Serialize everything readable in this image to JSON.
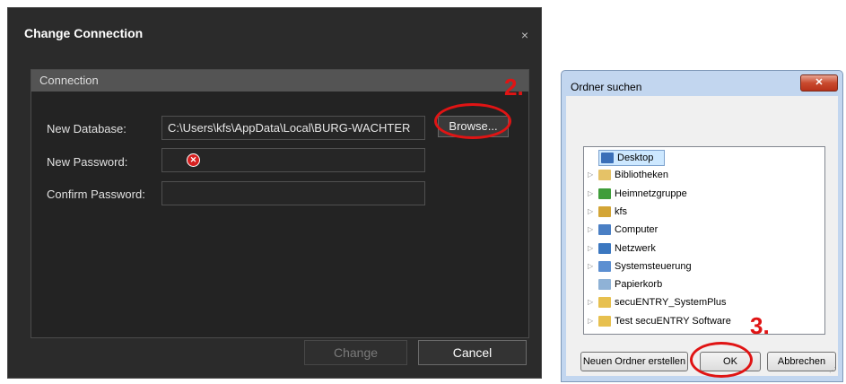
{
  "dark_dialog": {
    "title": "Change Connection",
    "close_glyph": "×",
    "section_header": "Connection",
    "new_database_label": "New Database:",
    "new_database_value": "C:\\Users\\kfs\\AppData\\Local\\BURG-WACHTER",
    "browse_label": "Browse...",
    "new_password_label": "New Password:",
    "confirm_password_label": "Confirm Password:",
    "change_label": "Change",
    "cancel_label": "Cancel",
    "error_glyph": "✕"
  },
  "annotations": {
    "step2": "2.",
    "step3": "3.",
    "color": "#e01414"
  },
  "folder_dialog": {
    "title": "Ordner suchen",
    "close_glyph": "✕",
    "tree": [
      {
        "label": "Desktop",
        "icon": "desktop-icon",
        "color": "#3a6fb8",
        "expander": "",
        "selected": true
      },
      {
        "label": "Bibliotheken",
        "icon": "library-icon",
        "color": "#e5c267",
        "expander": "▷"
      },
      {
        "label": "Heimnetzgruppe",
        "icon": "homegroup-icon",
        "color": "#3f9d3a",
        "expander": "▷"
      },
      {
        "label": "kfs",
        "icon": "user-folder-icon",
        "color": "#d3a536",
        "expander": "▷"
      },
      {
        "label": "Computer",
        "icon": "computer-icon",
        "color": "#4a7fc4",
        "expander": "▷"
      },
      {
        "label": "Netzwerk",
        "icon": "network-icon",
        "color": "#3b77c0",
        "expander": "▷"
      },
      {
        "label": "Systemsteuerung",
        "icon": "control-panel-icon",
        "color": "#5c8fd1",
        "expander": "▷"
      },
      {
        "label": "Papierkorb",
        "icon": "recycle-bin-icon",
        "color": "#8fb2d6",
        "expander": ""
      },
      {
        "label": "secuENTRY_SystemPlus",
        "icon": "folder-icon",
        "color": "#e7c04f",
        "expander": "▷"
      },
      {
        "label": "Test secuENTRY Software",
        "icon": "folder-icon",
        "color": "#e7c04f",
        "expander": "▷"
      }
    ],
    "new_folder_label": "Neuen Ordner erstellen",
    "ok_label": "OK",
    "cancel_label": "Abbrechen"
  }
}
